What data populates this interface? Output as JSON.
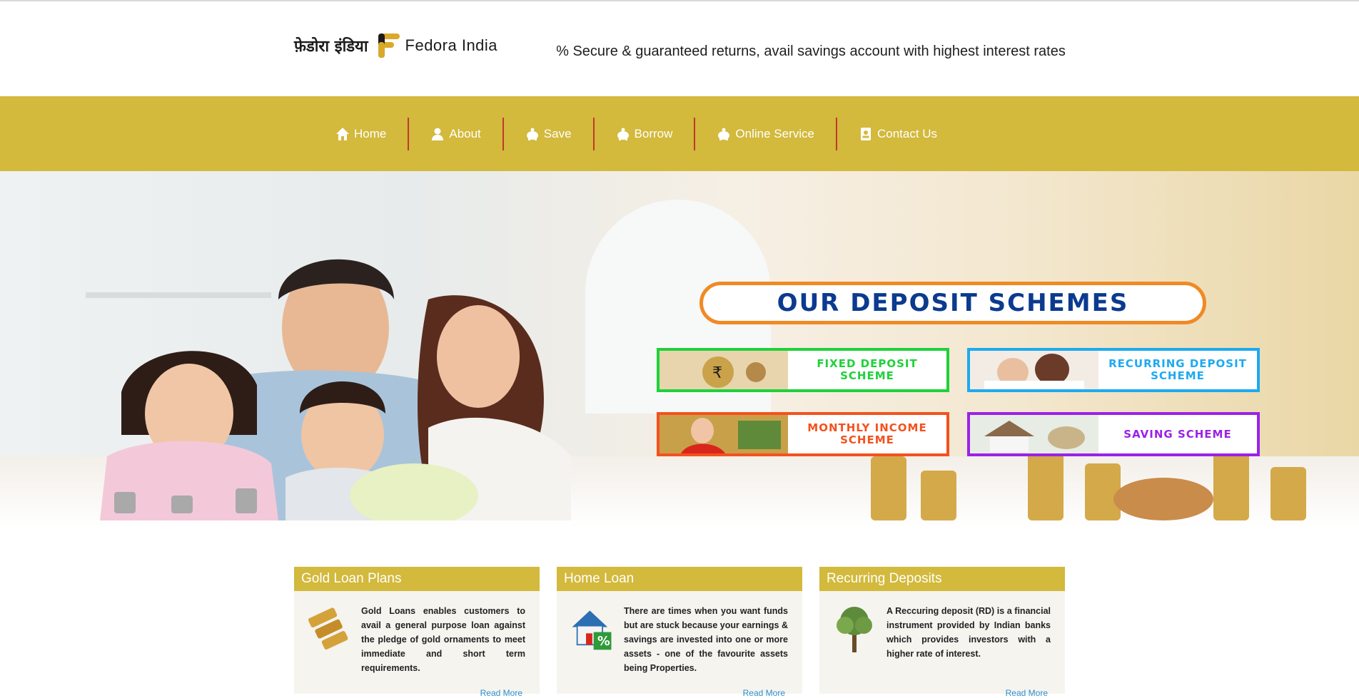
{
  "header": {
    "brand_hindi": "फ़ेडोरा इंडिया",
    "brand_name": "Fedora India",
    "marquee": "0% Secure & guaranteed returns, avail savings account with highest interest rates"
  },
  "nav": {
    "items": [
      {
        "label": "Home",
        "icon": "home-icon"
      },
      {
        "label": "About",
        "icon": "user-icon"
      },
      {
        "label": "Save",
        "icon": "piggy-bank-icon"
      },
      {
        "label": "Borrow",
        "icon": "piggy-bank-icon"
      },
      {
        "label": "Online Service",
        "icon": "piggy-bank-icon"
      },
      {
        "label": "Contact Us",
        "icon": "contact-card-icon"
      }
    ],
    "separator_color": "#c0392b"
  },
  "hero": {
    "title": "OUR DEPOSIT SCHEMES",
    "schemes": [
      {
        "label_1": "FIXED DEPOSIT",
        "label_2": "SCHEME",
        "color": "#1fd13a"
      },
      {
        "label_1": "RECURRING DEPOSIT",
        "label_2": "SCHEME",
        "color": "#1eaaf0"
      },
      {
        "label_1": "MONTHLY INCOME",
        "label_2": "SCHEME",
        "color": "#f4511e"
      },
      {
        "label_1": "SAVING SCHEME",
        "label_2": "",
        "color": "#9b21e8"
      }
    ]
  },
  "cards": [
    {
      "title": "Gold Loan Plans",
      "text": "Gold Loans enables customers to avail a general purpose loan against the pledge of gold ornaments to meet immediate and short term requirements.",
      "more": "Read More",
      "icon": "gold-loan-icon"
    },
    {
      "title": "Home Loan",
      "text": "There are times when you want funds but are stuck because your earnings & savings are invested into one or more assets - one of the favourite assets being Properties.",
      "more": "Read More",
      "icon": "house-percent-icon"
    },
    {
      "title": "Recurring Deposits",
      "text": "A Reccuring deposit (RD) is a financial instrument provided by Indian banks which provides investors with a higher rate of interest.",
      "more": "Read More",
      "icon": "money-tree-icon"
    }
  ],
  "colors": {
    "brand_gold": "#d3b93c",
    "title_blue": "#0b3a8f",
    "title_border": "#f08a24"
  }
}
